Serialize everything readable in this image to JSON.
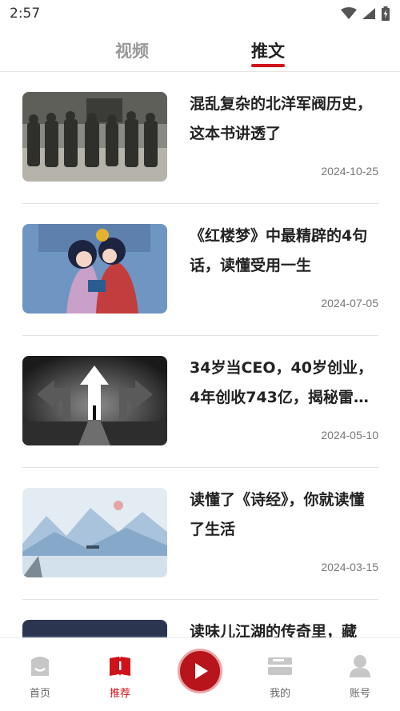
{
  "status": {
    "time": "2:57"
  },
  "tabs": [
    {
      "label": "视频",
      "active": false
    },
    {
      "label": "推文",
      "active": true
    }
  ],
  "articles": [
    {
      "title": "混乱复杂的北洋军阀历史，这本书讲透了",
      "date": "2024-10-25",
      "thumb": "historical-photo"
    },
    {
      "title": "《红楼梦》中最精辟的4句话，读懂受用一生",
      "date": "2024-07-05",
      "thumb": "illustration-girls"
    },
    {
      "title": "34岁当CEO，40岁创业，4年创收743亿，揭秘雷…",
      "date": "2024-05-10",
      "thumb": "arrows-road"
    },
    {
      "title": "读懂了《诗经》，你就读懂了生活",
      "date": "2024-03-15",
      "thumb": "ink-landscape"
    },
    {
      "title": "读味儿江湖的传奇里，藏",
      "date": "",
      "thumb": "dark-scene"
    }
  ],
  "bottom_nav": {
    "items": [
      {
        "label": "首页",
        "icon": "home-icon",
        "active": false
      },
      {
        "label": "推荐",
        "icon": "book-icon",
        "active": true
      },
      {
        "label": "我的",
        "icon": "shelf-icon",
        "active": false
      },
      {
        "label": "账号",
        "icon": "user-icon",
        "active": false
      }
    ],
    "center_icon": "play-icon"
  },
  "colors": {
    "accent": "#d0121b",
    "text": "#222222",
    "muted": "#999999"
  }
}
